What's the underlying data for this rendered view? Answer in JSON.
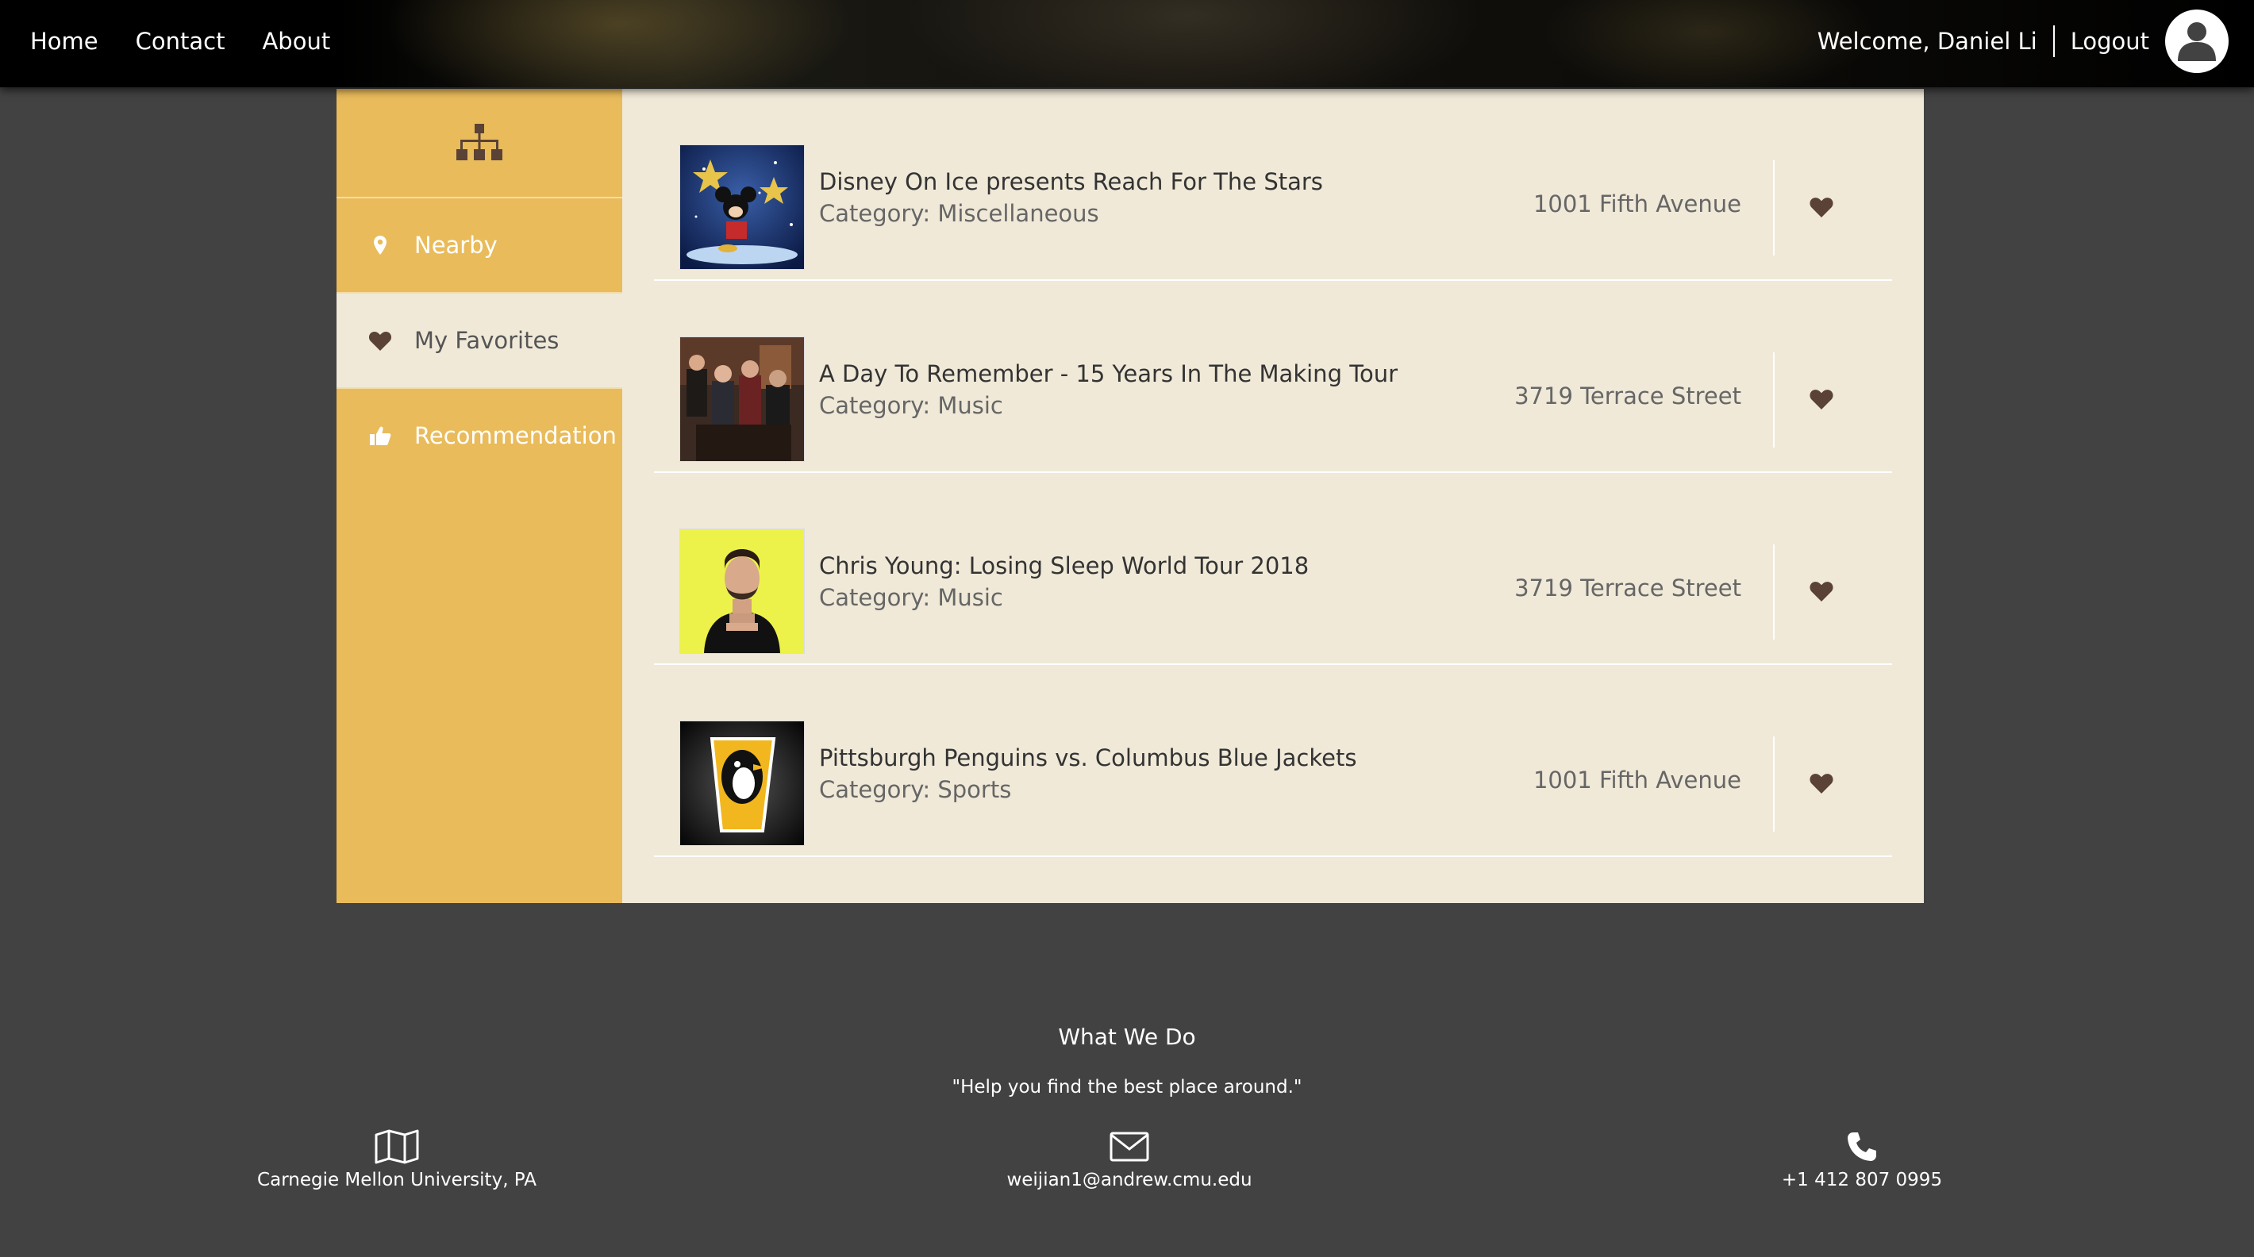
{
  "nav": {
    "home": "Home",
    "contact": "Contact",
    "about": "About",
    "welcome": "Welcome, Daniel Li",
    "logout": "Logout"
  },
  "sidebar": {
    "items": [
      {
        "label": "Nearby",
        "icon": "map-marker-icon"
      },
      {
        "label": "My Favorites",
        "icon": "heart-icon",
        "active": true
      },
      {
        "label": "Recommendation",
        "icon": "thumbs-up-icon"
      }
    ]
  },
  "items": [
    {
      "title": "Disney On Ice presents Reach For The Stars",
      "category": "Category: Miscellaneous",
      "address": "1001 Fifth Avenue",
      "favorite": true
    },
    {
      "title": "A Day To Remember - 15 Years In The Making Tour",
      "category": "Category: Music",
      "address": "3719 Terrace Street",
      "favorite": true
    },
    {
      "title": "Chris Young: Losing Sleep World Tour 2018",
      "category": "Category: Music",
      "address": "3719 Terrace Street",
      "favorite": true
    },
    {
      "title": "Pittsburgh Penguins vs. Columbus Blue Jackets",
      "category": "Category: Sports",
      "address": "1001 Fifth Avenue",
      "favorite": true
    }
  ],
  "footer": {
    "title": "What We Do",
    "quote": "\"Help you find the best place around.\"",
    "location": "Carnegie Mellon University, PA",
    "email": "weijian1@andrew.cmu.edu",
    "phone": "+1 412 807 0995"
  },
  "colors": {
    "accent": "#e9bb5b",
    "panel": "#f0e9d8",
    "background": "#424242",
    "heart": "#5a4236"
  }
}
